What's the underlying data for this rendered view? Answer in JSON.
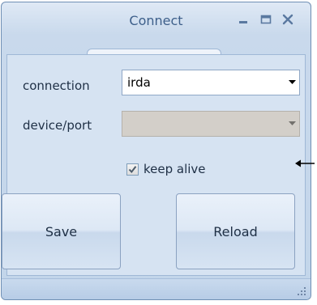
{
  "window": {
    "title": "Connect"
  },
  "fields": {
    "connection_label": "connection",
    "connection_value": "irda",
    "device_label": "device/port",
    "device_value": ""
  },
  "options": {
    "keep_alive_label": "keep alive",
    "keep_alive_checked": true
  },
  "buttons": {
    "save_label": "Save",
    "reload_label": "Reload"
  },
  "icons": {
    "minimize": "minimize-icon",
    "maximize": "maximize-icon",
    "close": "close-icon",
    "dropdown": "chevron-down-icon",
    "check": "checkmark-icon",
    "arrow": "left-arrow-icon",
    "grip": "resize-grip-icon"
  },
  "colors": {
    "title_text": "#3d5f8a",
    "window_bg": "#c9d9ec"
  }
}
